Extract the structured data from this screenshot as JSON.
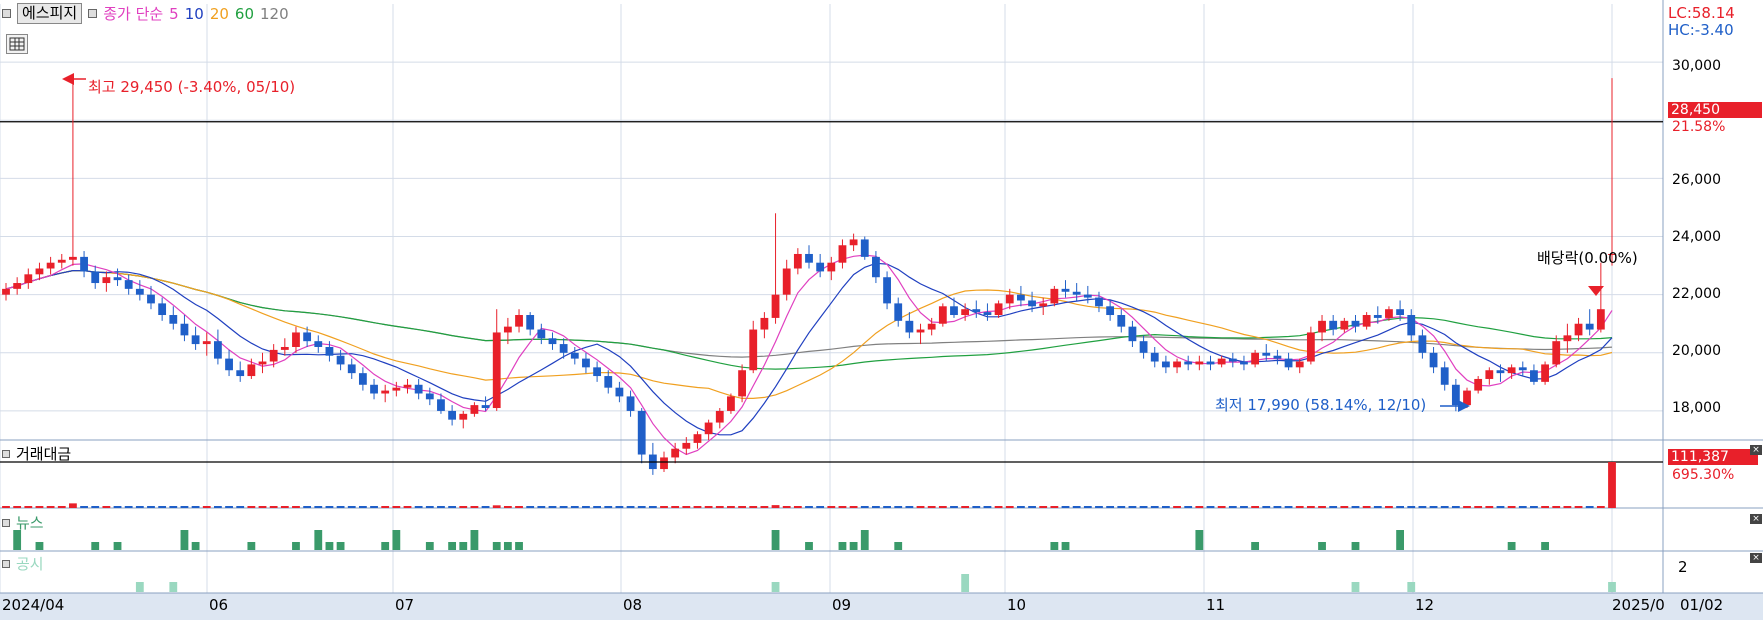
{
  "header": {
    "stock_name": "에스피지",
    "indicator_label": "종가 단순",
    "ma_periods": [
      {
        "label": "5",
        "color": "#e040c0"
      },
      {
        "label": "10",
        "color": "#2040c0"
      },
      {
        "label": "20",
        "color": "#f0a020"
      },
      {
        "label": "60",
        "color": "#20a040"
      },
      {
        "label": "120",
        "color": "#808080"
      }
    ]
  },
  "right_top": {
    "lc": "LC:58.14",
    "hc": "HC:-3.40"
  },
  "price_axis": {
    "ticks": [
      "30,000",
      "28,000",
      "26,000",
      "24,000",
      "22,000",
      "20,000",
      "18,000"
    ],
    "tick_values": [
      30000,
      28000,
      26000,
      24000,
      22000,
      20000,
      18000
    ],
    "current_price": "28,450",
    "current_change": "21.58%",
    "ylim": [
      17000,
      32000
    ]
  },
  "annotations": {
    "high": "최고 29,450 (-3.40%, 05/10)",
    "low": "최저 17,990 (58.14%, 12/10)",
    "dividend": "배당락(0.00%)"
  },
  "volume_panel": {
    "title": "거래대금",
    "current_value": "111,387",
    "current_change": "695.30%"
  },
  "news_panel": {
    "title": "뉴스"
  },
  "disclosure_panel": {
    "title": "공시",
    "axis_tick": "2"
  },
  "x_axis": {
    "labels": [
      "2024/04",
      "06",
      "07",
      "08",
      "09",
      "10",
      "11",
      "12",
      "2025/0",
      "01/02"
    ]
  },
  "colors": {
    "up": "#e8202a",
    "down": "#1f5fc8",
    "green_bar": "#3a9a6a",
    "grid": "#d4dce8"
  },
  "chart_data": {
    "type": "candlestick",
    "description_series": "daily candles",
    "ohlc": [
      [
        22000,
        22400,
        21800,
        22200
      ],
      [
        22200,
        22600,
        22000,
        22400
      ],
      [
        22400,
        22900,
        22200,
        22700
      ],
      [
        22700,
        23100,
        22500,
        22900
      ],
      [
        22900,
        23300,
        22700,
        23100
      ],
      [
        23100,
        23400,
        22900,
        23200
      ],
      [
        23200,
        29450,
        23000,
        23300
      ],
      [
        23300,
        23500,
        22600,
        22800
      ],
      [
        22800,
        23000,
        22200,
        22400
      ],
      [
        22400,
        22800,
        22100,
        22600
      ],
      [
        22600,
        22900,
        22300,
        22500
      ],
      [
        22500,
        22700,
        22000,
        22200
      ],
      [
        22200,
        22500,
        21800,
        22000
      ],
      [
        22000,
        22300,
        21500,
        21700
      ],
      [
        21700,
        21900,
        21100,
        21300
      ],
      [
        21300,
        21600,
        20800,
        21000
      ],
      [
        21000,
        21300,
        20400,
        20600
      ],
      [
        20600,
        20900,
        20100,
        20300
      ],
      [
        20300,
        20700,
        19900,
        20400
      ],
      [
        20400,
        20800,
        19600,
        19800
      ],
      [
        19800,
        20100,
        19200,
        19400
      ],
      [
        19400,
        19700,
        19000,
        19200
      ],
      [
        19200,
        19800,
        19100,
        19600
      ],
      [
        19600,
        20000,
        19300,
        19700
      ],
      [
        19700,
        20300,
        19500,
        20100
      ],
      [
        20100,
        20500,
        19900,
        20200
      ],
      [
        20200,
        20900,
        20000,
        20700
      ],
      [
        20700,
        20900,
        20200,
        20400
      ],
      [
        20400,
        20600,
        20000,
        20200
      ],
      [
        20200,
        20400,
        19700,
        19900
      ],
      [
        19900,
        20100,
        19400,
        19600
      ],
      [
        19600,
        19800,
        19100,
        19300
      ],
      [
        19300,
        19500,
        18700,
        18900
      ],
      [
        18900,
        19100,
        18400,
        18600
      ],
      [
        18600,
        18900,
        18300,
        18700
      ],
      [
        18700,
        19000,
        18500,
        18800
      ],
      [
        18800,
        19100,
        18600,
        18900
      ],
      [
        18900,
        19100,
        18400,
        18600
      ],
      [
        18600,
        18800,
        18200,
        18400
      ],
      [
        18400,
        18600,
        17900,
        18000
      ],
      [
        18000,
        18200,
        17500,
        17700
      ],
      [
        17700,
        18000,
        17400,
        17900
      ],
      [
        17900,
        18300,
        17800,
        18200
      ],
      [
        18200,
        18500,
        18000,
        18100
      ],
      [
        18100,
        21500,
        18000,
        20700
      ],
      [
        20700,
        21200,
        20300,
        20900
      ],
      [
        20900,
        21500,
        20700,
        21300
      ],
      [
        21300,
        21400,
        20600,
        20800
      ],
      [
        20800,
        21000,
        20300,
        20500
      ],
      [
        20500,
        20700,
        20100,
        20300
      ],
      [
        20300,
        20500,
        19800,
        20000
      ],
      [
        20000,
        20200,
        19600,
        19800
      ],
      [
        19800,
        20000,
        19300,
        19500
      ],
      [
        19500,
        19700,
        19000,
        19200
      ],
      [
        19200,
        19400,
        18600,
        18800
      ],
      [
        18800,
        19000,
        18300,
        18500
      ],
      [
        18500,
        18700,
        17800,
        18000
      ],
      [
        18000,
        18100,
        16200,
        16500
      ],
      [
        16500,
        16900,
        15800,
        16000
      ],
      [
        16000,
        16600,
        15900,
        16400
      ],
      [
        16400,
        16900,
        16200,
        16700
      ],
      [
        16700,
        17100,
        16500,
        16900
      ],
      [
        16900,
        17300,
        16700,
        17200
      ],
      [
        17200,
        17700,
        17000,
        17600
      ],
      [
        17600,
        18100,
        17400,
        18000
      ],
      [
        18000,
        18600,
        17900,
        18500
      ],
      [
        18500,
        19600,
        18300,
        19400
      ],
      [
        19400,
        21100,
        19300,
        20800
      ],
      [
        20800,
        21400,
        20500,
        21200
      ],
      [
        21200,
        24800,
        21000,
        22000
      ],
      [
        22000,
        23200,
        21800,
        22900
      ],
      [
        22900,
        23600,
        22700,
        23400
      ],
      [
        23400,
        23700,
        22900,
        23100
      ],
      [
        23100,
        23400,
        22600,
        22800
      ],
      [
        22800,
        23300,
        22500,
        23100
      ],
      [
        23100,
        23900,
        22900,
        23700
      ],
      [
        23700,
        24100,
        23500,
        23900
      ],
      [
        23900,
        24000,
        23200,
        23300
      ],
      [
        23300,
        23500,
        22400,
        22600
      ],
      [
        22600,
        22800,
        21500,
        21700
      ],
      [
        21700,
        21900,
        20900,
        21100
      ],
      [
        21100,
        21400,
        20500,
        20700
      ],
      [
        20700,
        21000,
        20300,
        20800
      ],
      [
        20800,
        21200,
        20600,
        21000
      ],
      [
        21000,
        21700,
        20900,
        21600
      ],
      [
        21600,
        21900,
        21200,
        21300
      ],
      [
        21300,
        21700,
        21100,
        21500
      ],
      [
        21500,
        21800,
        21200,
        21400
      ],
      [
        21400,
        21700,
        21100,
        21300
      ],
      [
        21300,
        21800,
        21200,
        21700
      ],
      [
        21700,
        22200,
        21500,
        22000
      ],
      [
        22000,
        22300,
        21600,
        21800
      ],
      [
        21800,
        22100,
        21400,
        21600
      ],
      [
        21600,
        21900,
        21300,
        21700
      ],
      [
        21700,
        22300,
        21600,
        22200
      ],
      [
        22200,
        22500,
        21900,
        22100
      ],
      [
        22100,
        22400,
        21800,
        22000
      ],
      [
        22000,
        22300,
        21700,
        21900
      ],
      [
        21900,
        22100,
        21400,
        21600
      ],
      [
        21600,
        21800,
        21100,
        21300
      ],
      [
        21300,
        21500,
        20700,
        20900
      ],
      [
        20900,
        21100,
        20200,
        20400
      ],
      [
        20400,
        20600,
        19800,
        20000
      ],
      [
        20000,
        20200,
        19500,
        19700
      ],
      [
        19700,
        19900,
        19300,
        19500
      ],
      [
        19500,
        19800,
        19300,
        19700
      ],
      [
        19700,
        19900,
        19400,
        19600
      ],
      [
        19600,
        19900,
        19400,
        19700
      ],
      [
        19700,
        19900,
        19400,
        19600
      ],
      [
        19600,
        19900,
        19500,
        19800
      ],
      [
        19800,
        20000,
        19500,
        19700
      ],
      [
        19700,
        19900,
        19400,
        19600
      ],
      [
        19600,
        20100,
        19500,
        20000
      ],
      [
        20000,
        20300,
        19700,
        19900
      ],
      [
        19900,
        20100,
        19600,
        19800
      ],
      [
        19800,
        20000,
        19400,
        19500
      ],
      [
        19500,
        19800,
        19300,
        19700
      ],
      [
        19700,
        20900,
        19600,
        20700
      ],
      [
        20700,
        21300,
        20400,
        21100
      ],
      [
        21100,
        21300,
        20600,
        20800
      ],
      [
        20800,
        21200,
        20700,
        21100
      ],
      [
        21100,
        21300,
        20700,
        20900
      ],
      [
        20900,
        21400,
        20800,
        21300
      ],
      [
        21300,
        21600,
        21000,
        21200
      ],
      [
        21200,
        21600,
        21100,
        21500
      ],
      [
        21500,
        21800,
        21100,
        21300
      ],
      [
        21300,
        21500,
        20400,
        20600
      ],
      [
        20600,
        20800,
        19800,
        20000
      ],
      [
        20000,
        20200,
        19300,
        19500
      ],
      [
        19500,
        19700,
        18700,
        18900
      ],
      [
        18900,
        19100,
        17990,
        18200
      ],
      [
        18200,
        18800,
        18100,
        18700
      ],
      [
        18700,
        19200,
        18600,
        19100
      ],
      [
        19100,
        19500,
        18900,
        19400
      ],
      [
        19400,
        19600,
        19000,
        19300
      ],
      [
        19300,
        19600,
        19100,
        19500
      ],
      [
        19500,
        19700,
        19200,
        19400
      ],
      [
        19400,
        19600,
        18900,
        19000
      ],
      [
        19000,
        19700,
        18900,
        19600
      ],
      [
        19600,
        20600,
        19500,
        20400
      ],
      [
        20400,
        21000,
        20000,
        20600
      ],
      [
        20600,
        21200,
        20400,
        21000
      ],
      [
        21000,
        21500,
        20600,
        20800
      ],
      [
        20800,
        23100,
        20700,
        21500
      ],
      [
        23400,
        29450,
        23000,
        23400
      ]
    ],
    "annotated_high": 29450,
    "annotated_low": 17990,
    "x_ticks": [
      "2024/04",
      "06",
      "07",
      "08",
      "09",
      "10",
      "11",
      "12",
      "2025/0"
    ]
  }
}
